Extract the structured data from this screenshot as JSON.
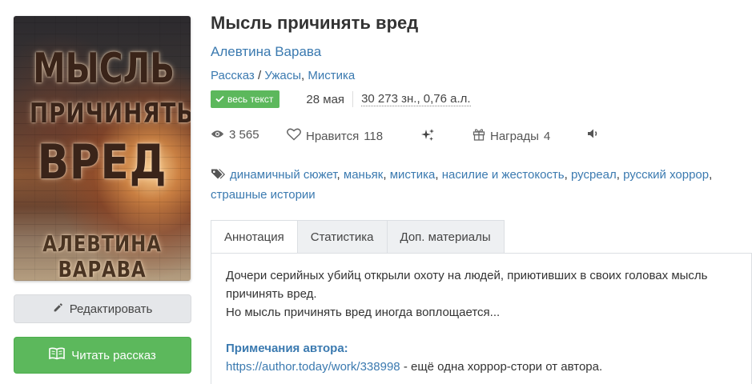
{
  "cover": {
    "title_line1": "МЫСЛЬ",
    "title_line2": "ПРИЧИНЯТЬ",
    "title_line3": "ВРЕД",
    "author_line1": "АЛЕВТИНА",
    "author_line2": "ВАРАВА"
  },
  "buttons": {
    "edit_label": "Редактировать",
    "read_label": "Читать рассказ"
  },
  "book": {
    "title": "Мысль причинять вред",
    "author": "Алевтина Варава",
    "form": "Рассказ",
    "genre_sep": " / ",
    "genre1": "Ужасы",
    "genre_comma": ", ",
    "genre2": "Мистика",
    "status_badge": "весь текст",
    "date": "28 мая",
    "size": "30 273 зн., 0,76 а.л."
  },
  "stats": {
    "views": "3 565",
    "likes_label": "Нравится",
    "likes_count": "118",
    "awards_label": "Награды",
    "awards_count": "4"
  },
  "tags": [
    "динамичный сюжет",
    "маньяк",
    "мистика",
    "насилие и жестокость",
    "русреал",
    "русский хоррор",
    "страшные истории"
  ],
  "tabs": [
    "Аннотация",
    "Статистика",
    "Доп. материалы"
  ],
  "annotation": {
    "line1": "Дочери серийных убийц открыли охоту на людей, приютивших в своих головах мысль причинять вред.",
    "line2": "Но мысль причинять вред иногда воплощается...",
    "notes_header": "Примечания автора:",
    "notes_link": "https://author.today/work/338998",
    "notes_text": " - ещё одна хоррор-стори от автора."
  },
  "colors": {
    "link": "#3b7ab0",
    "read_button": "#5cb85c",
    "badge": "#5cb85c"
  },
  "icons": {
    "edit": "pencil-icon",
    "read": "book-icon",
    "badge": "check-icon",
    "views": "eye-icon",
    "likes": "heart-icon",
    "sparkle": "sparkle-icon",
    "awards": "gift-icon",
    "audio": "speaker-icon",
    "tags": "tags-icon"
  }
}
